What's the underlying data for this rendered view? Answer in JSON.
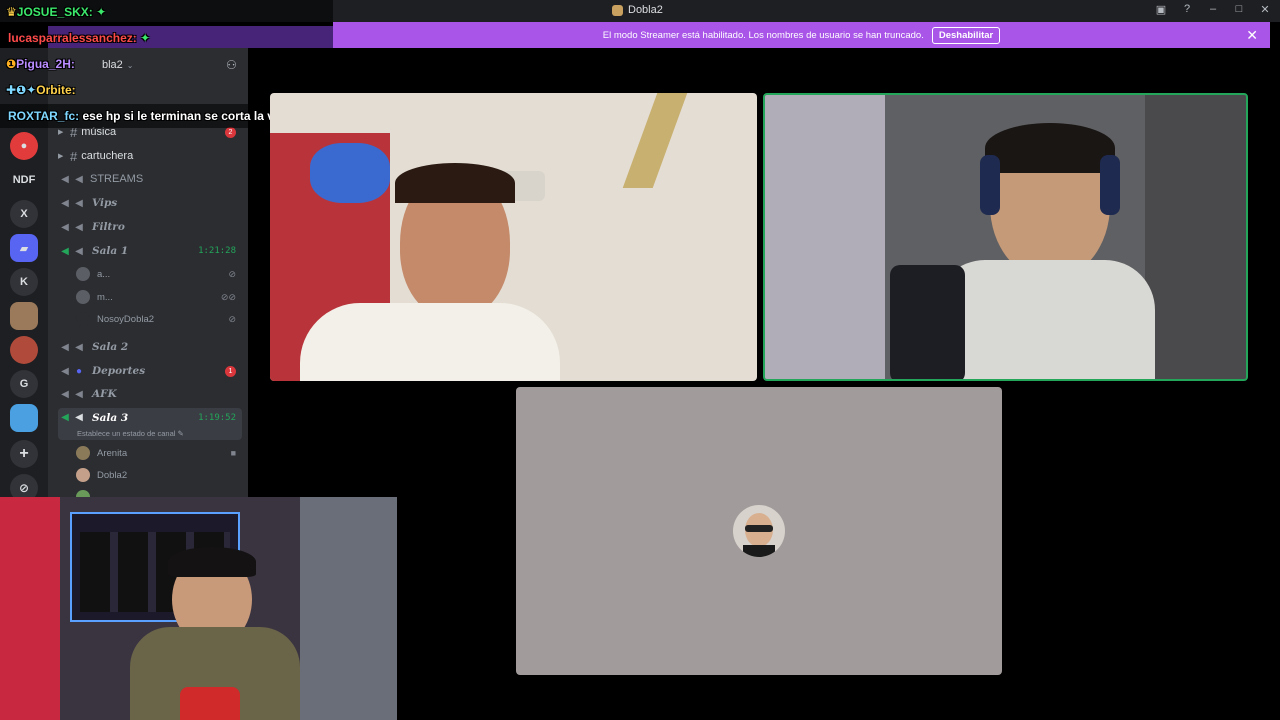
{
  "window": {
    "title": "Dobla2"
  },
  "banner": {
    "message": "El modo Streamer está habilitado. Los nombres de usuario se han truncado.",
    "button_label": "Deshabilitar"
  },
  "rail": {
    "labels": {
      "ndf": "NDF",
      "x": "X",
      "k": "K",
      "g": "G"
    }
  },
  "channels": {
    "partial_top": "bla2",
    "items": {
      "musica": "música",
      "cartuchera": "cartuchera",
      "streams": "STREAMS",
      "vips": "Vips",
      "filtro": "Filtro",
      "sala1": "Sala 1",
      "sala2": "Sala 2",
      "deportes": "Deportes",
      "afk": "AFK",
      "sala3": "Sala 3"
    },
    "sala1_timer": "1:21:28",
    "sala3_timer": "1:19:52",
    "musica_badge": "2",
    "deportes_badge": "1",
    "sala1_users": [
      "a...",
      "m...",
      "NosoyDobla2"
    ],
    "sala3_status": "Establece un estado de canal",
    "sala3_users": [
      "Arenita",
      "Dobla2"
    ]
  },
  "chat": [
    {
      "user": "JOSUE_SKX:",
      "text": "",
      "color": "#3be86b"
    },
    {
      "user": "lucasparralessanchez:",
      "text": "",
      "color": "#ff4a4a"
    },
    {
      "user": "Pigua_2H:",
      "text": "",
      "color": "#b98cff"
    },
    {
      "user": "Orbite:",
      "text": "",
      "color": "#ffd24a"
    },
    {
      "user": "ROXTAR_fc:",
      "text": "ese hp si le terminan se corta la vena",
      "color": "#7fd8ff"
    }
  ],
  "colors": {
    "accent": "#a855e8",
    "speaking": "#23a55a"
  }
}
